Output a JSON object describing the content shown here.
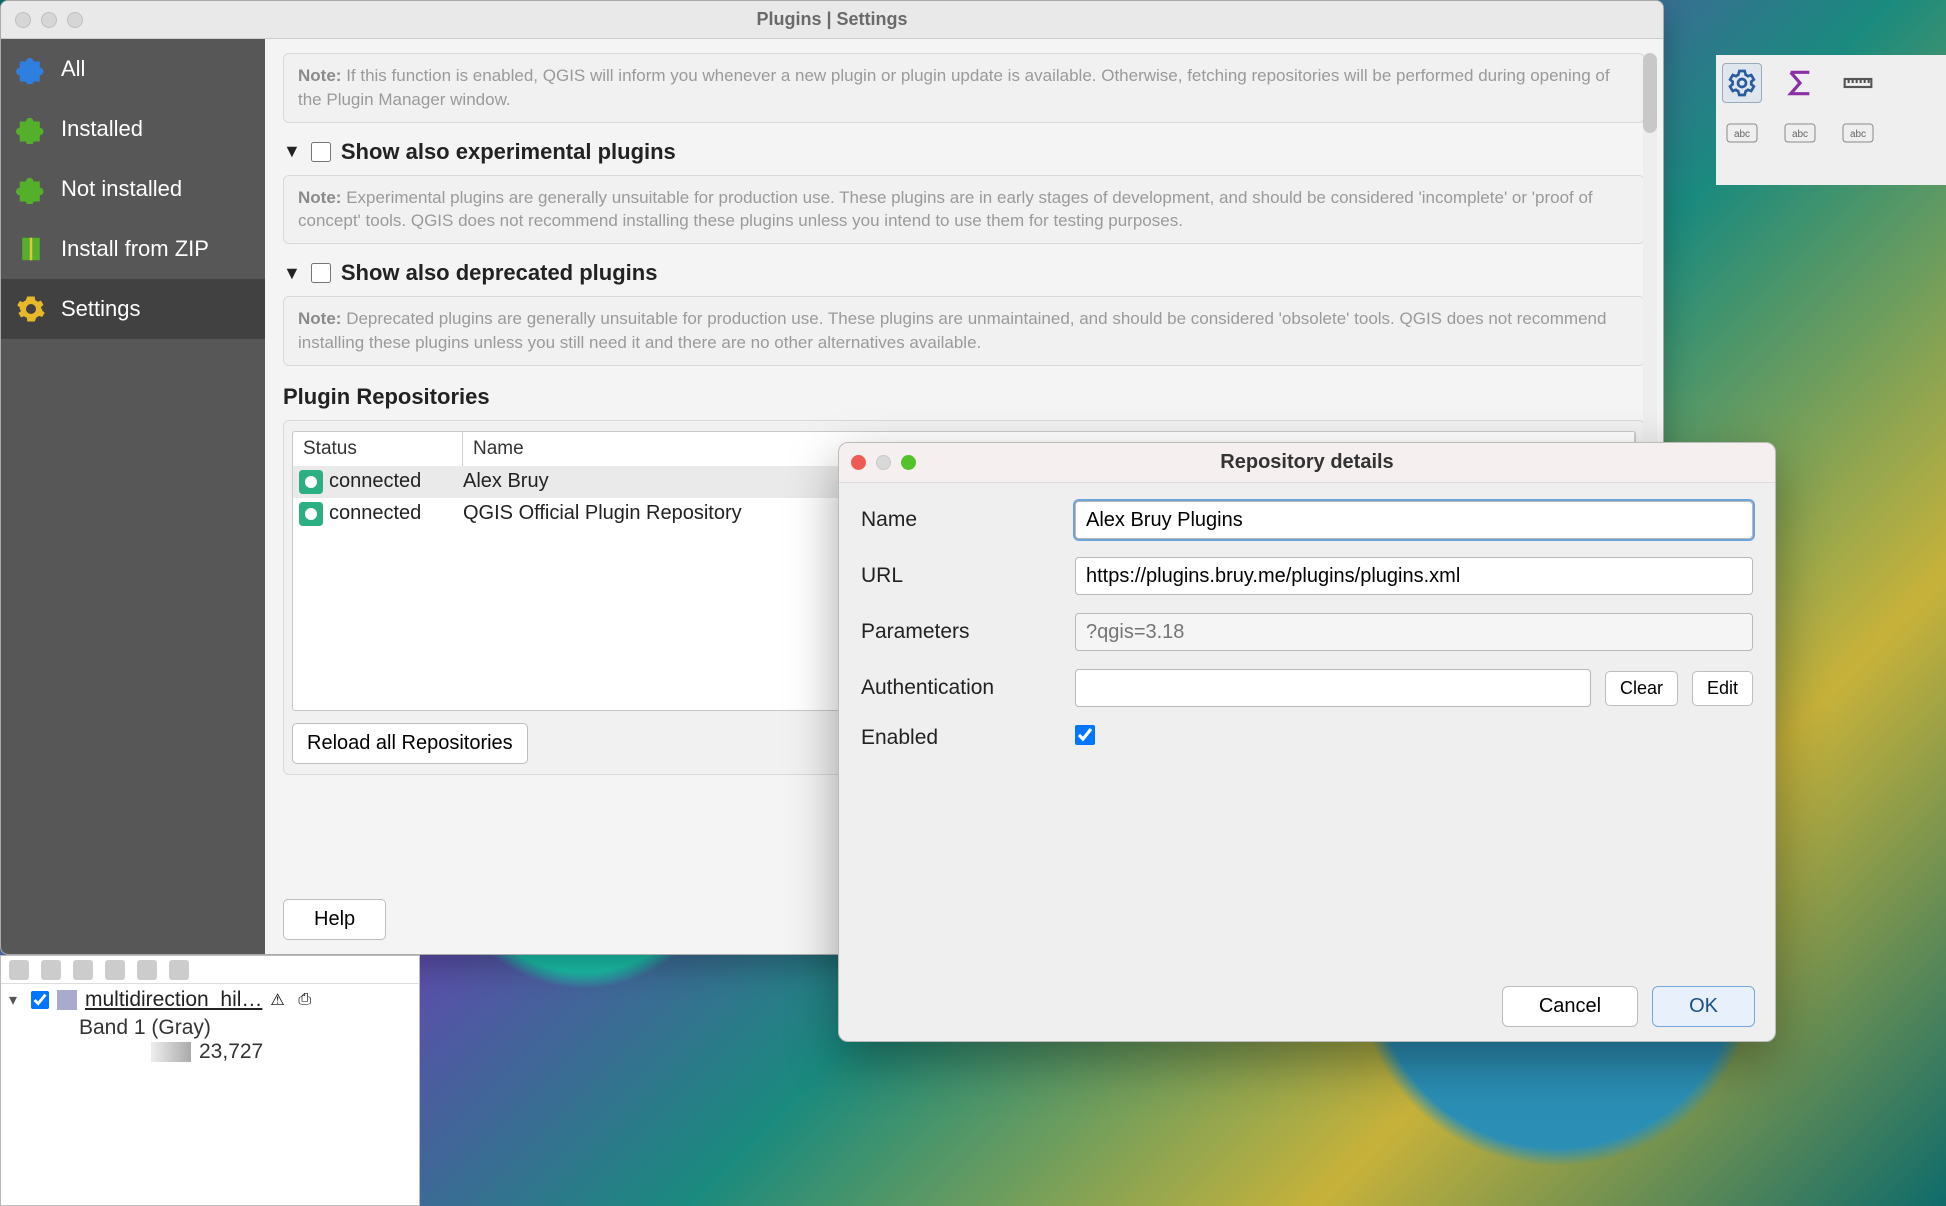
{
  "window": {
    "title": "Plugins | Settings"
  },
  "sidebar": {
    "items": [
      {
        "label": "All"
      },
      {
        "label": "Installed"
      },
      {
        "label": "Not installed"
      },
      {
        "label": "Install from ZIP"
      },
      {
        "label": "Settings"
      }
    ],
    "selected_index": 4
  },
  "notes": {
    "updates": "If this function is enabled, QGIS will inform you whenever a new plugin or plugin update is available. Otherwise, fetching repositories will be performed during opening of the Plugin Manager window.",
    "experimental_label": "Show also experimental plugins",
    "experimental_note": "Experimental plugins are generally unsuitable for production use. These plugins are in early stages of development, and should be considered 'incomplete' or 'proof of concept' tools. QGIS does not recommend installing these plugins unless you intend to use them for testing purposes.",
    "deprecated_label": "Show also deprecated plugins",
    "deprecated_note": "Deprecated plugins are generally unsuitable for production use. These plugins are unmaintained, and should be considered 'obsolete' tools. QGIS does not recommend installing these plugins unless you still need it and there are no other alternatives available.",
    "note_prefix": "Note:"
  },
  "repos": {
    "title": "Plugin Repositories",
    "headers": {
      "status": "Status",
      "name": "Name"
    },
    "rows": [
      {
        "status": "connected",
        "name": "Alex Bruy"
      },
      {
        "status": "connected",
        "name": "QGIS Official Plugin Repository"
      }
    ],
    "reload_label": "Reload all Repositories"
  },
  "buttons": {
    "help": "Help"
  },
  "dialog": {
    "title": "Repository details",
    "labels": {
      "name": "Name",
      "url": "URL",
      "parameters": "Parameters",
      "authentication": "Authentication",
      "enabled": "Enabled"
    },
    "values": {
      "name": "Alex Bruy Plugins",
      "url": "https://plugins.bruy.me/plugins/plugins.xml",
      "parameters_placeholder": "?qgis=3.18",
      "authentication": "",
      "enabled": true
    },
    "buttons": {
      "clear": "Clear",
      "edit": "Edit",
      "cancel": "Cancel",
      "ok": "OK"
    }
  },
  "layers": {
    "name": "multidirection_hil…",
    "band": "Band 1 (Gray)",
    "value": "23,727"
  }
}
